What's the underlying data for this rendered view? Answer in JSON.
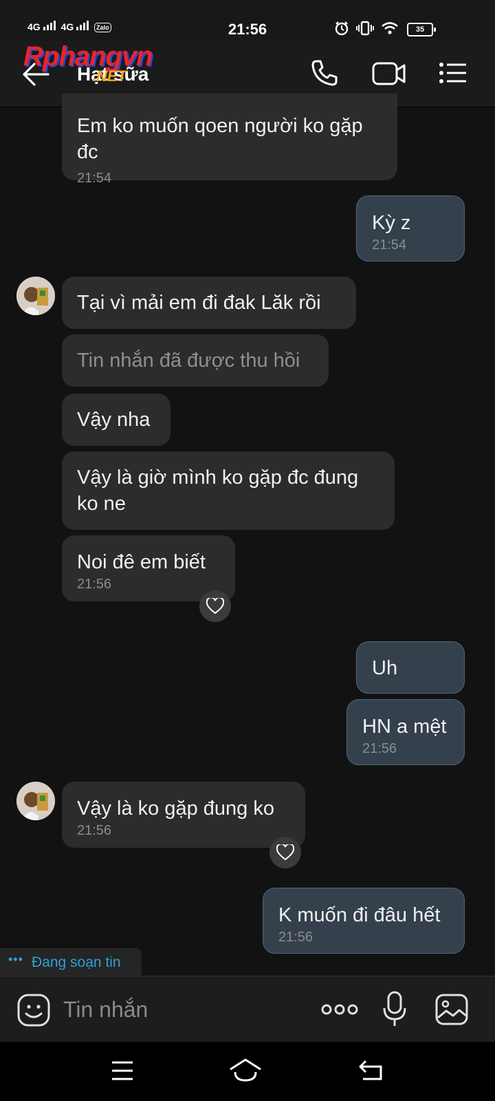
{
  "status_bar": {
    "network1": "4G",
    "network2": "4G",
    "app_badge": "Zalo",
    "time": "21:56",
    "battery": "35",
    "icons": [
      "alarm-icon",
      "vibrate-icon",
      "wifi-icon"
    ]
  },
  "header": {
    "contact_name": "Hạt sữa",
    "watermark_logo": "Rphangvn",
    "watermark_suffix": ".NET",
    "icons": [
      "back-arrow-icon",
      "phone-icon",
      "video-call-icon",
      "menu-list-icon"
    ]
  },
  "messages": [
    {
      "id": 1,
      "side": "in",
      "lines": [
        "Em ko muốn qoen người ko gặp",
        "đc"
      ],
      "time": "21:54"
    },
    {
      "id": 2,
      "side": "out",
      "lines": [
        "Kỳ z"
      ],
      "time": "21:54"
    },
    {
      "id": 3,
      "side": "in",
      "lines": [
        "Tại vì mải em đi đak Lăk rồi"
      ],
      "time": ""
    },
    {
      "id": 4,
      "side": "in",
      "lines": [
        "Tin nhắn đã được thu hồi"
      ],
      "time": "",
      "recalled": true
    },
    {
      "id": 5,
      "side": "in",
      "lines": [
        "Vậy nha"
      ],
      "time": ""
    },
    {
      "id": 6,
      "side": "in",
      "lines": [
        "Vậy là giờ mình ko gặp đc đung",
        "ko ne"
      ],
      "time": ""
    },
    {
      "id": 7,
      "side": "in",
      "lines": [
        "Noi đê em biết"
      ],
      "time": "21:56",
      "reaction": "heart"
    },
    {
      "id": 8,
      "side": "out",
      "lines": [
        "Uh"
      ],
      "time": ""
    },
    {
      "id": 9,
      "side": "out",
      "lines": [
        "HN a mệt"
      ],
      "time": "21:56"
    },
    {
      "id": 10,
      "side": "in",
      "lines": [
        "Vậy là ko gặp đung ko"
      ],
      "time": "21:56",
      "reaction": "heart"
    },
    {
      "id": 11,
      "side": "out",
      "lines": [
        "K muốn đi đâu hết"
      ],
      "time": "21:56"
    }
  ],
  "typing_indicator": {
    "dots": "•••",
    "label": "Đang soạn tin"
  },
  "composer": {
    "placeholder": "Tin nhắn",
    "icons": [
      "sticker-icon",
      "more-icon",
      "microphone-icon",
      "gallery-icon"
    ]
  },
  "nav_bar": {
    "icons": [
      "recent-apps-icon",
      "home-icon",
      "back-icon"
    ]
  },
  "colors": {
    "background": "#121212",
    "incoming_bubble": "#2c2c2c",
    "outgoing_bubble": "#35404d",
    "typing_accent": "#2aa3d8"
  }
}
